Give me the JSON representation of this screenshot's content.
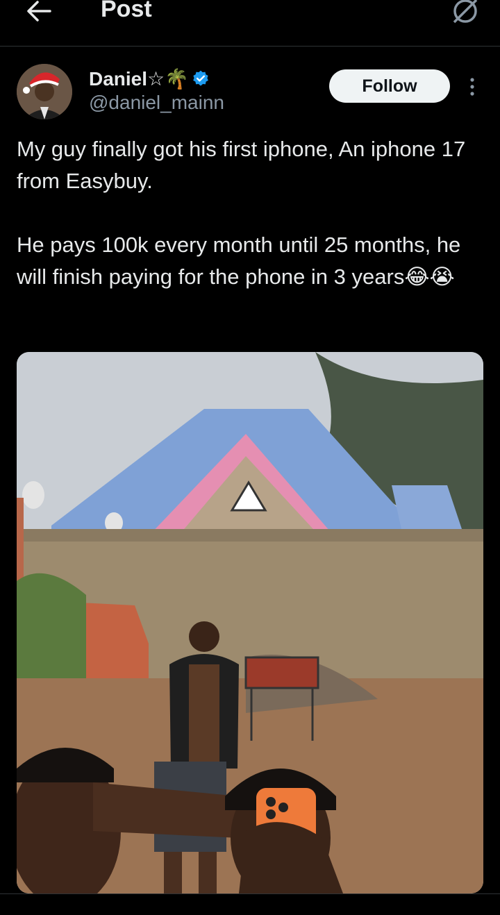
{
  "header": {
    "title": "Post"
  },
  "author": {
    "name": "Daniel☆🌴",
    "handle": "@daniel_mainn",
    "follow_label": "Follow"
  },
  "post": {
    "line1": "My guy finally got his first iphone,  An iphone 17 from Easybuy.",
    "line2": "He pays 100k every month until 25 months, he will finish paying for the phone in 3 years😂😭"
  },
  "colors": {
    "verified": "#1d9bf0",
    "follow_bg": "#eff3f4",
    "secondary_text": "#8b98a5"
  },
  "icons": {
    "back": "arrow-left-icon",
    "grok": "grok-icon",
    "verified": "verified-badge-icon",
    "more": "more-vertical-icon"
  }
}
